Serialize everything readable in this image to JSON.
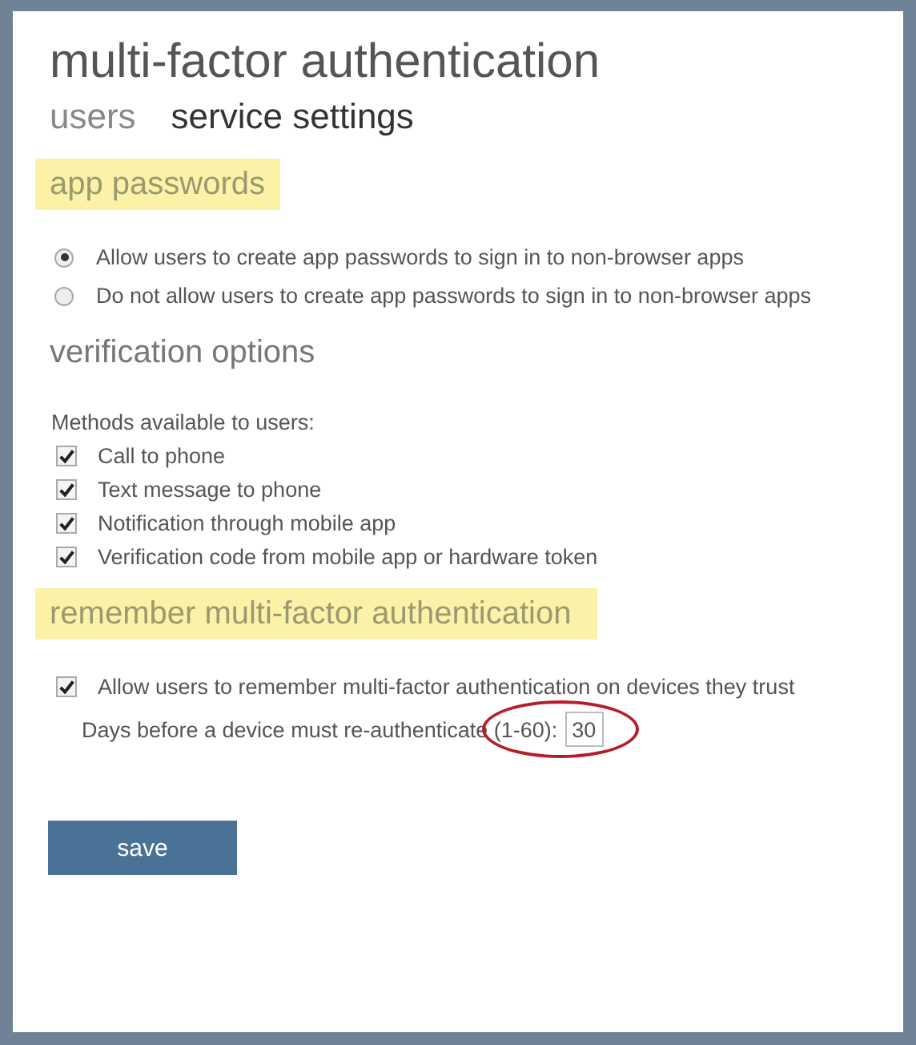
{
  "title": "multi-factor authentication",
  "tabs": [
    {
      "label": "users",
      "selected": false
    },
    {
      "label": "service settings",
      "selected": true
    }
  ],
  "app_passwords": {
    "heading": "app passwords",
    "highlighted": true,
    "options": [
      {
        "label": "Allow users to create app passwords to sign in to non-browser apps",
        "selected": true
      },
      {
        "label": "Do not allow users to create app passwords to sign in to non-browser apps",
        "selected": false
      }
    ]
  },
  "verification_options": {
    "heading": "verification options",
    "highlighted": false,
    "methods_label": "Methods available to users:",
    "methods": [
      {
        "label": "Call to phone",
        "checked": true
      },
      {
        "label": "Text message to phone",
        "checked": true
      },
      {
        "label": "Notification through mobile app",
        "checked": true
      },
      {
        "label": "Verification code from mobile app or hardware token",
        "checked": true
      }
    ]
  },
  "remember": {
    "heading": "remember multi-factor authentication",
    "highlighted": true,
    "allow": {
      "label": "Allow users to remember multi-factor authentication on devices they trust",
      "checked": true
    },
    "days_label": "Days before a device must re-authenticate (1-60):",
    "days_value": "30",
    "circled": true
  },
  "save_button": "save"
}
